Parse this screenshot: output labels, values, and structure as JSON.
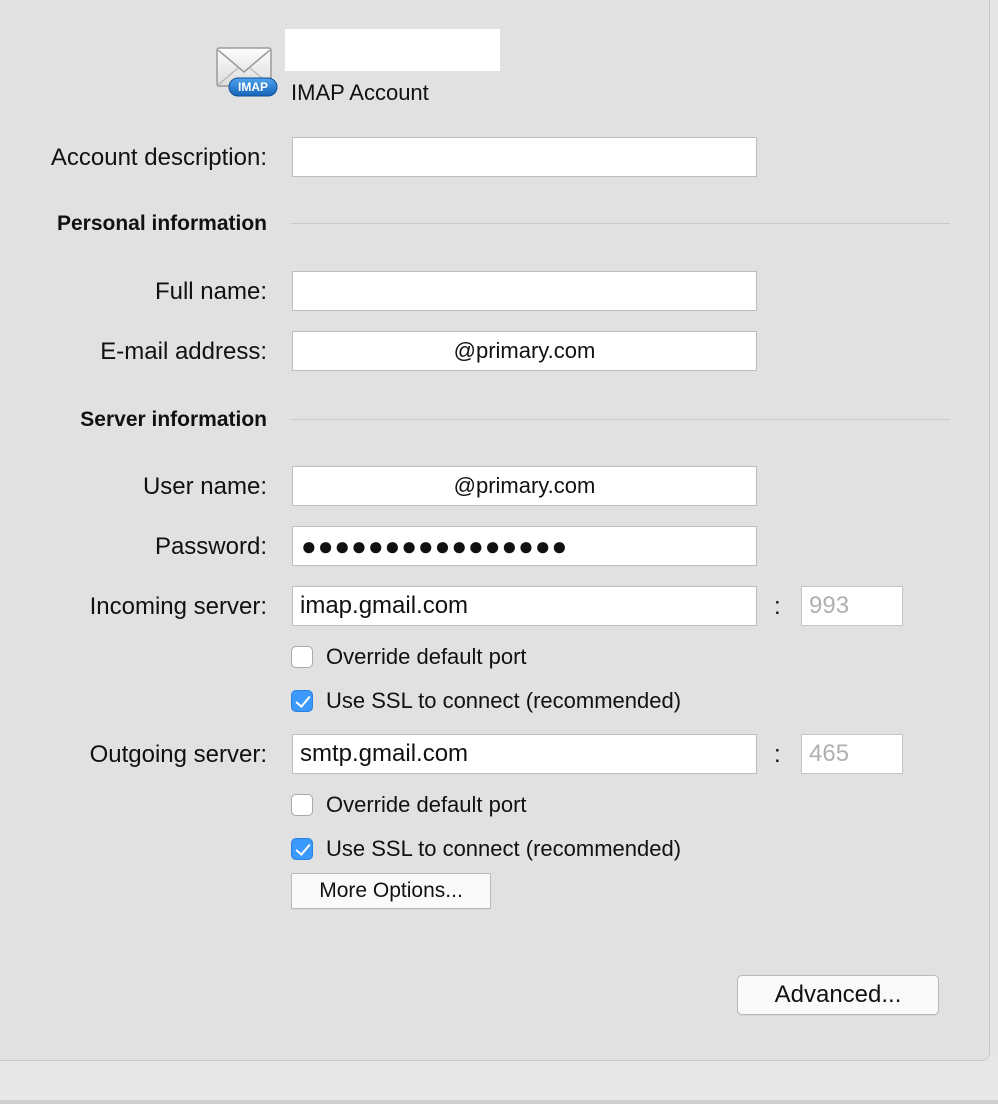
{
  "account": {
    "name_value": "",
    "type_label": "IMAP Account",
    "icon": "imap-mail-icon",
    "icon_badge": "IMAP"
  },
  "fields": {
    "description_label": "Account description:",
    "description_value": ""
  },
  "personal": {
    "heading": "Personal information",
    "full_name_label": "Full name:",
    "full_name_value": "",
    "email_label": "E-mail address:",
    "email_value": "@primary.com"
  },
  "server": {
    "heading": "Server information",
    "username_label": "User name:",
    "username_value": "@primary.com",
    "password_label": "Password:",
    "password_value": "●●●●●●●●●●●●●●●●",
    "incoming_label": "Incoming server:",
    "incoming_value": "imap.gmail.com",
    "incoming_port_placeholder": "993",
    "outgoing_label": "Outgoing server:",
    "outgoing_value": "smtp.gmail.com",
    "outgoing_port_placeholder": "465",
    "colon": ":"
  },
  "options": {
    "incoming_override_label": "Override default port",
    "incoming_override_checked": false,
    "incoming_ssl_label": "Use SSL to connect (recommended)",
    "incoming_ssl_checked": true,
    "outgoing_override_label": "Override default port",
    "outgoing_override_checked": false,
    "outgoing_ssl_label": "Use SSL to connect (recommended)",
    "outgoing_ssl_checked": true
  },
  "buttons": {
    "more_options": "More Options...",
    "advanced": "Advanced..."
  },
  "colors": {
    "panel_bg": "#e1e1e1",
    "checkbox_on": "#3b99fc",
    "icon_badge": "#1f7ad1"
  }
}
